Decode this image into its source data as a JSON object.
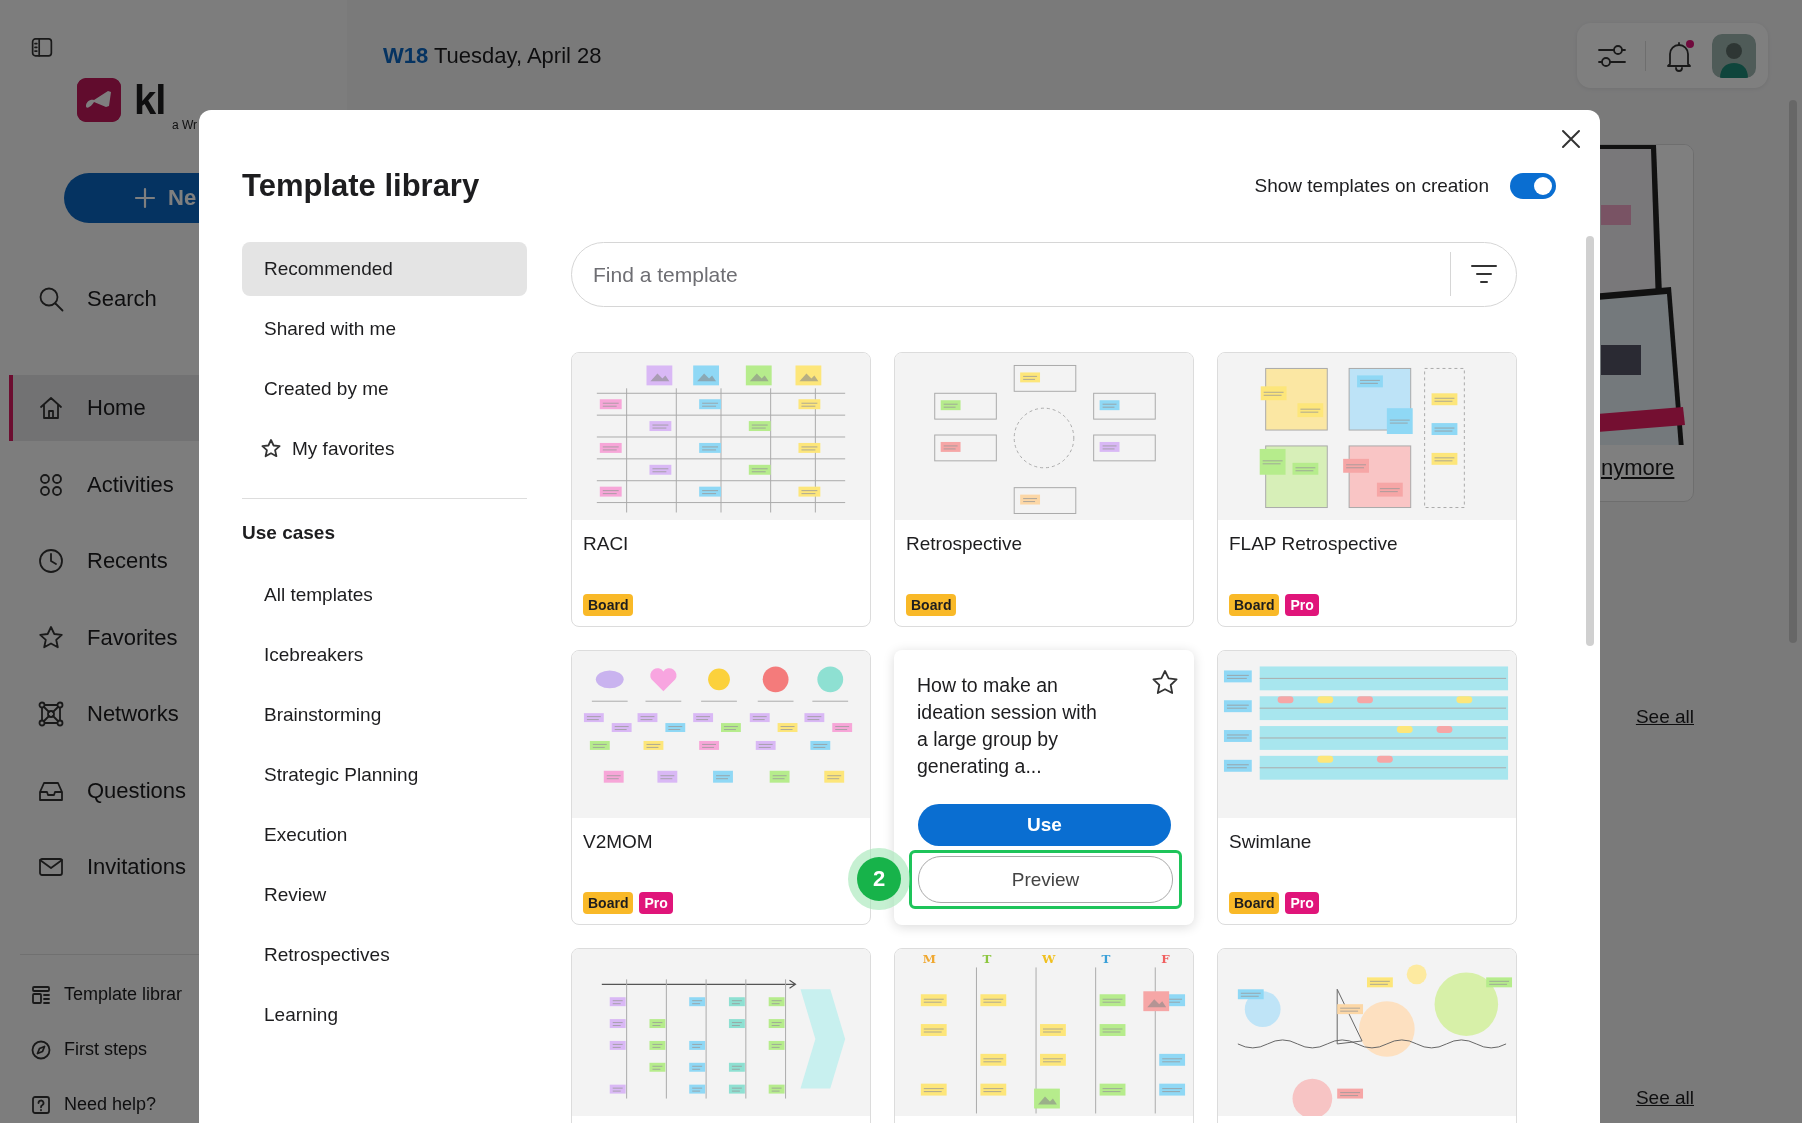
{
  "app": {
    "sidebar": {
      "logo_text": "kl",
      "logo_subtitle": "a Wr",
      "new_button": "Ne",
      "search_label": "Search",
      "nav": [
        {
          "label": "Home",
          "selected": true
        },
        {
          "label": "Activities",
          "selected": false
        },
        {
          "label": "Recents",
          "selected": false
        },
        {
          "label": "Favorites",
          "selected": false
        },
        {
          "label": "Networks",
          "selected": false
        },
        {
          "label": "Questions",
          "selected": false
        },
        {
          "label": "Invitations",
          "selected": false
        }
      ],
      "footer": [
        "Template librar",
        "First steps",
        "Need help?"
      ]
    },
    "header": {
      "week": "W18",
      "date": "Tuesday, April 28",
      "notifications_unread": true
    },
    "promo": {
      "kind": "picture",
      "link": "nymore"
    },
    "see_all": [
      "See all",
      "See all"
    ]
  },
  "modal": {
    "title": "Template library",
    "toggle": {
      "label": "Show templates on creation",
      "on": true
    },
    "nav": [
      {
        "label": "Recommended",
        "selected": true
      },
      {
        "label": "Shared with me",
        "selected": false
      },
      {
        "label": "Created by me",
        "selected": false
      },
      {
        "label": "My favorites",
        "selected": false
      }
    ],
    "section_title": "Use cases",
    "use_cases": [
      {
        "label": "All templates",
        "selected": false
      },
      {
        "label": "Icebreakers",
        "selected": false
      },
      {
        "label": "Brainstorming",
        "selected": false
      },
      {
        "label": "Strategic Planning",
        "selected": false
      },
      {
        "label": "Execution",
        "selected": false
      },
      {
        "label": "Review",
        "selected": false
      },
      {
        "label": "Retrospectives",
        "selected": false
      },
      {
        "label": "Learning",
        "selected": false
      }
    ],
    "search": {
      "placeholder": "Find a template"
    },
    "templates": [
      {
        "kind": "card",
        "title": "RACI",
        "badges": [
          {
            "label": "Board",
            "color": "#f9b928"
          }
        ]
      },
      {
        "kind": "card",
        "title": "Retrospective",
        "badges": [
          {
            "label": "Board",
            "color": "#f9b928"
          }
        ]
      },
      {
        "kind": "card",
        "title": "FLAP Retrospective",
        "badges": [
          {
            "label": "Board",
            "color": "#f9b928"
          },
          {
            "label": "Pro",
            "color": "#e0157a"
          }
        ]
      },
      {
        "kind": "card",
        "title": "V2MOM",
        "badges": [
          {
            "label": "Board",
            "color": "#f9b928"
          },
          {
            "label": "Pro",
            "color": "#e0157a"
          }
        ]
      },
      {
        "kind": "hover",
        "description": "How to make an ideation session with a large group by generating a...",
        "favorite": false,
        "use_button": "Use",
        "preview_button": "Preview",
        "step": "2"
      },
      {
        "kind": "card",
        "title": "Swimlane",
        "badges": [
          {
            "label": "Board",
            "color": "#f9b928"
          },
          {
            "label": "Pro",
            "color": "#e0157a"
          }
        ]
      },
      {
        "kind": "card"
      },
      {
        "kind": "card",
        "thumbnail_labels": [
          "M",
          "T",
          "W",
          "T",
          "F"
        ]
      },
      {
        "kind": "card"
      }
    ]
  }
}
